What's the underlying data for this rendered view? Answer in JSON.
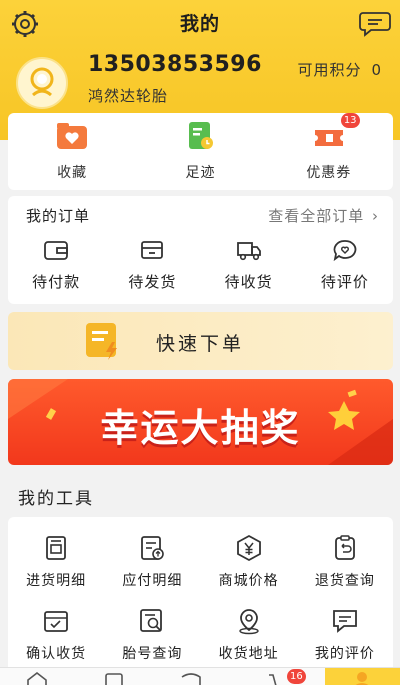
{
  "header": {
    "title": "我的"
  },
  "user": {
    "phone": "13503853596",
    "shop_name": "鸿然达轮胎",
    "points_label": "可用积分",
    "points_value": "0"
  },
  "quick_actions": [
    {
      "label": "收藏",
      "icon": "heart-folder-icon"
    },
    {
      "label": "足迹",
      "icon": "footprint-icon"
    },
    {
      "label": "优惠券",
      "icon": "coupon-icon",
      "badge": "13"
    }
  ],
  "orders": {
    "title": "我的订单",
    "view_all": "查看全部订单",
    "items": [
      {
        "label": "待付款",
        "icon": "wallet-icon"
      },
      {
        "label": "待发货",
        "icon": "box-icon"
      },
      {
        "label": "待收货",
        "icon": "truck-icon"
      },
      {
        "label": "待评价",
        "icon": "comment-icon"
      }
    ]
  },
  "fast_order": {
    "label": "快速下单"
  },
  "lottery": {
    "label": "幸运大抽奖"
  },
  "tools": {
    "title": "我的工具",
    "items": [
      {
        "label": "进货明细",
        "icon": "purchase-detail-icon"
      },
      {
        "label": "应付明细",
        "icon": "payable-detail-icon"
      },
      {
        "label": "商城价格",
        "icon": "price-icon"
      },
      {
        "label": "退货查询",
        "icon": "return-icon"
      },
      {
        "label": "确认收货",
        "icon": "confirm-receipt-icon"
      },
      {
        "label": "胎号查询",
        "icon": "tire-search-icon"
      },
      {
        "label": "收货地址",
        "icon": "location-icon"
      },
      {
        "label": "我的评价",
        "icon": "review-icon"
      }
    ]
  },
  "tabbar": {
    "cart_badge": "16"
  },
  "colors": {
    "brand_yellow": "#fcd23a",
    "accent_orange": "#f2381c",
    "badge_red": "#f0453b"
  }
}
